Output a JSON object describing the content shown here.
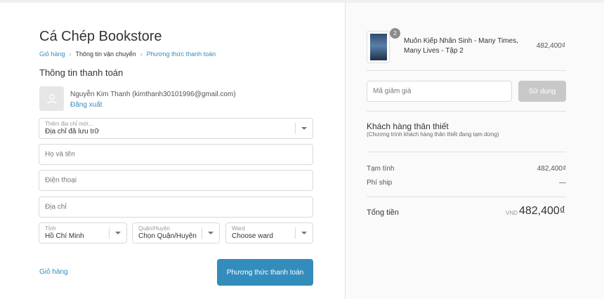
{
  "store": {
    "title": "Cá Chép Bookstore"
  },
  "breadcrumb": {
    "cart": "Giỏ hàng",
    "shipping": "Thông tin vận chuyển",
    "payment": "Phương thức thanh toán",
    "separator": "›"
  },
  "billing": {
    "section_title": "Thông tin thanh toán",
    "user_line": "Nguyễn Kim Thanh (kimthanh30101996@gmail.com)",
    "logout": "Đăng xuất"
  },
  "address_select": {
    "label": "Thêm địa chỉ mới...",
    "value": "Địa chỉ đã lưu trữ"
  },
  "fields": {
    "name_placeholder": "Họ và tên",
    "phone_placeholder": "Điện thoại",
    "address_placeholder": "Địa chỉ"
  },
  "province": {
    "label": "Tỉnh",
    "value": "Hồ Chí Minh"
  },
  "district": {
    "label": "Quận/Huyện",
    "value": "Chọn Quận/Huyện"
  },
  "ward": {
    "label": "Ward",
    "value": "Choose ward"
  },
  "actions": {
    "back_to_cart": "Giỏ hàng",
    "continue": "Phương thức thanh toán"
  },
  "cart": {
    "item": {
      "quantity": "2",
      "name": "Muôn Kiếp Nhân Sinh - Many Times, Many Lives - Tập 2",
      "price": "482,400₫"
    }
  },
  "coupon": {
    "placeholder": "Mã giảm giá",
    "apply": "Sử dụng"
  },
  "loyalty": {
    "title": "Khách hàng thân thiết",
    "subtitle": "(Chương trình khách hàng thân thiết đang tạm dừng)"
  },
  "summary": {
    "subtotal_label": "Tạm tính",
    "subtotal_value": "482,400₫",
    "shipping_label": "Phí ship",
    "shipping_value": "—",
    "total_label": "Tổng tiền",
    "currency": "VND",
    "total_value": "482,400₫"
  },
  "colors": {
    "accent": "#338dbc",
    "disabled_button": "#c8c8c8"
  }
}
